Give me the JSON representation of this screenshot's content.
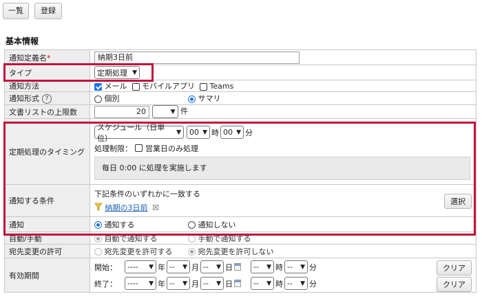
{
  "toolbar": {
    "list_label": "一覧",
    "register_label": "登録"
  },
  "section_title": "基本情報",
  "rows": {
    "name": {
      "label": "通知定義名",
      "required_mark": "*",
      "value": "納期3日前"
    },
    "type": {
      "label": "タイプ",
      "selected": "定期処理"
    },
    "method": {
      "label": "通知方法",
      "options": [
        "メール",
        "モバイルアプリ",
        "Teams"
      ]
    },
    "format": {
      "label": "通知形式",
      "help": "?",
      "options": [
        "個別",
        "サマリ"
      ]
    },
    "limit": {
      "label": "文書リストの上限数",
      "value": "20",
      "unit": "件"
    },
    "timing": {
      "label": "定期処理のタイミング",
      "schedule_selected": "スケジュール（日単位）",
      "hour_selected": "00",
      "hour_unit": "時",
      "minute_selected": "00",
      "minute_unit": "分",
      "restriction_label": "処理制限：",
      "restriction_option": "営業日のみ処理",
      "message": "毎日 0:00 に処理を実施します"
    },
    "condition": {
      "label": "通知する条件",
      "text": "下記条件のいずれかに一致する",
      "filter_link": "納期の3日前",
      "remove": "☒",
      "select_button": "選択"
    },
    "notify": {
      "label": "通知",
      "options": [
        "通知する",
        "通知しない"
      ]
    },
    "auto": {
      "label": "自動/手動",
      "options": [
        "自動で通知する",
        "手動で通知する"
      ]
    },
    "recipient": {
      "label": "宛先変更の許可",
      "options": [
        "宛先変更を許可する",
        "宛先変更を許可しない"
      ]
    },
    "period": {
      "label": "有効期間",
      "start_label": "開始：",
      "end_label": "終了：",
      "year_value": "----",
      "year_unit": "年",
      "month_value": "--",
      "month_unit": "月",
      "day_value": "--",
      "day_unit": "日",
      "hour_value": "--",
      "hour_unit": "時",
      "minute_value": "--",
      "minute_unit": "分",
      "clear_button": "クリア"
    }
  },
  "colors": {
    "highlight": "#c0143c",
    "accent": "#1a73e8",
    "link": "#1a5fb4"
  }
}
